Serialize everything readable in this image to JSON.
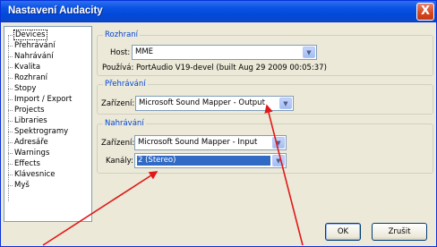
{
  "window": {
    "title": "Nastavení Audacity",
    "close_glyph": "X"
  },
  "sidebar": {
    "items": [
      {
        "label": "Devices",
        "selected": true
      },
      {
        "label": "Přehrávání"
      },
      {
        "label": "Nahrávání"
      },
      {
        "label": "Kvalita"
      },
      {
        "label": "Rozhraní"
      },
      {
        "label": "Stopy"
      },
      {
        "label": "Import / Export"
      },
      {
        "label": "Projects"
      },
      {
        "label": "Libraries"
      },
      {
        "label": "Spektrogramy"
      },
      {
        "label": "Adresáře"
      },
      {
        "label": "Warnings"
      },
      {
        "label": "Effects"
      },
      {
        "label": "Klávesnice"
      },
      {
        "label": "Myš"
      }
    ]
  },
  "interface_group": {
    "title": "Rozhraní",
    "host_label": "Host:",
    "host_value": "MME",
    "using_text": "Používá: PortAudio V19-devel (built Aug 29 2009 00:05:37)"
  },
  "playback_group": {
    "title": "Přehrávání",
    "device_label": "Zařízení:",
    "device_value": "Microsoft Sound Mapper - Output"
  },
  "recording_group": {
    "title": "Nahrávání",
    "device_label": "Zařízení:",
    "device_value": "Microsoft Sound Mapper - Input",
    "channels_label": "Kanály:",
    "channels_value": "2 (Stereo)"
  },
  "buttons": {
    "ok": "OK",
    "cancel": "Zrušit"
  },
  "colors": {
    "titlebar": "#0a53e2",
    "annotation_arrow": "#e01818",
    "selection": "#316ac5"
  },
  "icons": {
    "dropdown": "chevron-down-icon",
    "close": "close-icon"
  }
}
